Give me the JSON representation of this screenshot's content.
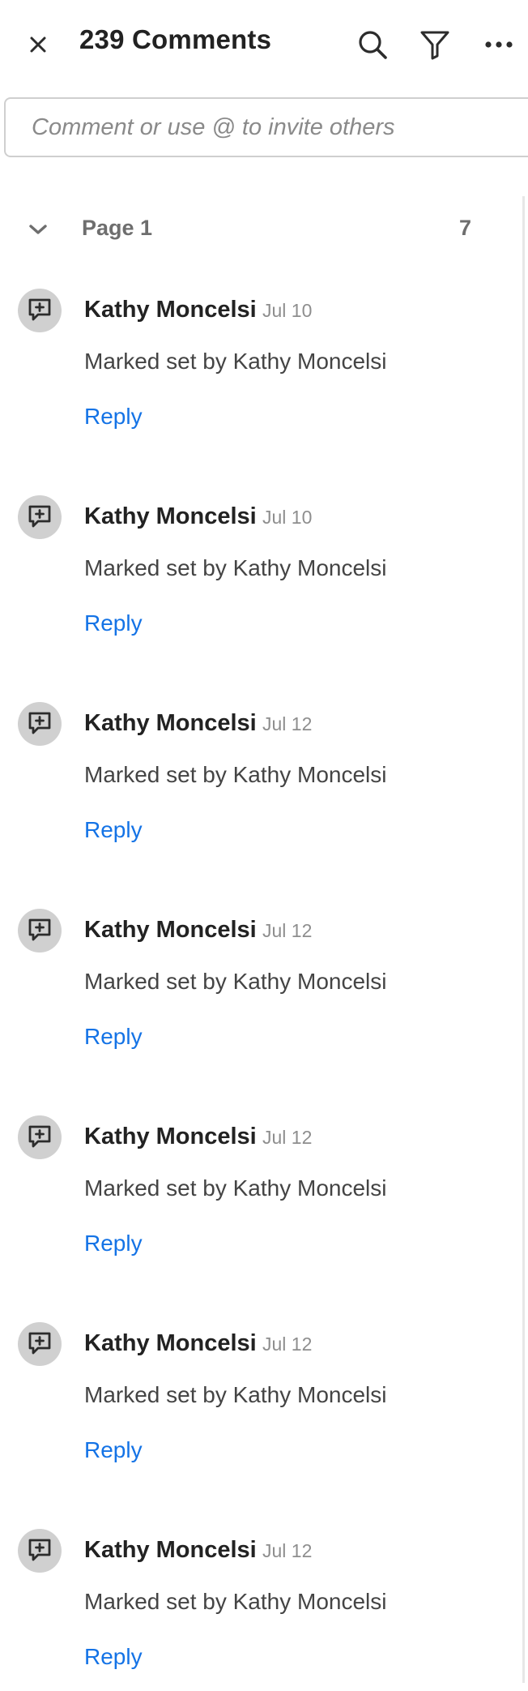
{
  "header": {
    "title": "239 Comments",
    "icons": [
      "close-icon",
      "search-icon",
      "filter-icon",
      "more-icon"
    ]
  },
  "comment_input": {
    "placeholder": "Comment or use @ to invite others"
  },
  "page_group": {
    "label": "Page 1",
    "count": "7",
    "state": "expanded"
  },
  "comments": [
    {
      "author": "Kathy Moncelsi",
      "date": "Jul 10",
      "text": "Marked set by Kathy Moncelsi",
      "reply_label": "Reply"
    },
    {
      "author": "Kathy Moncelsi",
      "date": "Jul 10",
      "text": "Marked set by Kathy Moncelsi",
      "reply_label": "Reply"
    },
    {
      "author": "Kathy Moncelsi",
      "date": "Jul 12",
      "text": "Marked set by Kathy Moncelsi",
      "reply_label": "Reply"
    },
    {
      "author": "Kathy Moncelsi",
      "date": "Jul 12",
      "text": "Marked set by Kathy Moncelsi",
      "reply_label": "Reply"
    },
    {
      "author": "Kathy Moncelsi",
      "date": "Jul 12",
      "text": "Marked set by Kathy Moncelsi",
      "reply_label": "Reply"
    },
    {
      "author": "Kathy Moncelsi",
      "date": "Jul 12",
      "text": "Marked set by Kathy Moncelsi",
      "reply_label": "Reply"
    },
    {
      "author": "Kathy Moncelsi",
      "date": "Jul 12",
      "text": "Marked set by Kathy Moncelsi",
      "reply_label": "Reply"
    }
  ],
  "colors": {
    "link": "#1473e6",
    "avatar_bg": "#d0d0d0",
    "muted_text": "#8e8e8e"
  }
}
